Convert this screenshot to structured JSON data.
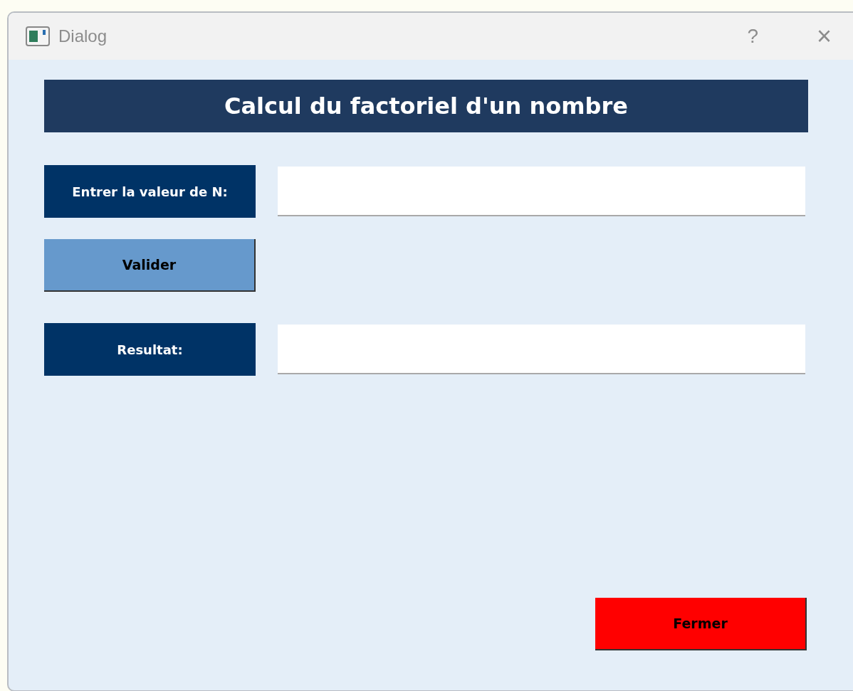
{
  "window": {
    "title": "Dialog",
    "help_glyph": "?",
    "close_glyph": "×"
  },
  "heading": "Calcul du factoriel d'un nombre",
  "fields": [
    {
      "label": "Entrer la valeur de N:"
    },
    {
      "label": "Resultat:"
    }
  ],
  "buttons": [
    {
      "label": "Valider",
      "kind": "validate"
    },
    {
      "label": "Fermer",
      "kind": "close"
    }
  ]
}
